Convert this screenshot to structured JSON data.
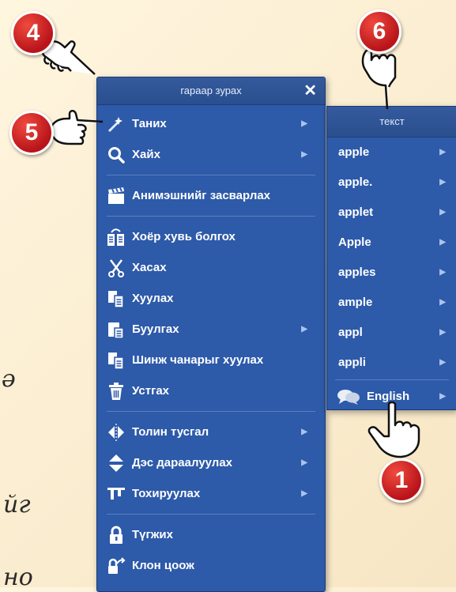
{
  "background": {
    "fragments": [
      "ə",
      "йг",
      "но"
    ]
  },
  "badges": [
    "4",
    "5",
    "6",
    "1"
  ],
  "menu": {
    "title": "гараар зурах",
    "close": "✕",
    "items": [
      {
        "label": "Таних",
        "icon": "magic-wand-icon",
        "submenu": true
      },
      {
        "label": "Хайх",
        "icon": "search-icon",
        "submenu": true
      },
      {
        "label": "Анимэшнийг засварлах",
        "icon": "clapperboard-icon",
        "submenu": false
      },
      {
        "label": "Хоёр хувь болгох",
        "icon": "duplicate-icon",
        "submenu": false
      },
      {
        "label": "Хасах",
        "icon": "scissors-icon",
        "submenu": false
      },
      {
        "label": "Хуулах",
        "icon": "copy-icon",
        "submenu": false
      },
      {
        "label": "Буулгах",
        "icon": "paste-icon",
        "submenu": true
      },
      {
        "label": "Шинж чанарыг хуулах",
        "icon": "copy-properties-icon",
        "submenu": false
      },
      {
        "label": "Устгах",
        "icon": "trash-icon",
        "submenu": false
      },
      {
        "label": "Толин тусгал",
        "icon": "mirror-icon",
        "submenu": true
      },
      {
        "label": "Дэс дараалуулах",
        "icon": "order-icon",
        "submenu": true
      },
      {
        "label": "Тохируулах",
        "icon": "align-icon",
        "submenu": true
      },
      {
        "label": "Түгжих",
        "icon": "lock-icon",
        "submenu": false
      },
      {
        "label": "Клон цоож",
        "icon": "clone-lock-icon",
        "submenu": false
      }
    ]
  },
  "submenu": {
    "title": "текст",
    "items": [
      "apple",
      "apple.",
      "applet",
      "Apple",
      "apples",
      "ample",
      "appl",
      "appli"
    ],
    "language": "English",
    "language_icon": "speech-bubbles-icon"
  },
  "colors": {
    "menu_bg": "#2d5aa9",
    "badge": "#c8181e",
    "background": "#fbeed2"
  }
}
